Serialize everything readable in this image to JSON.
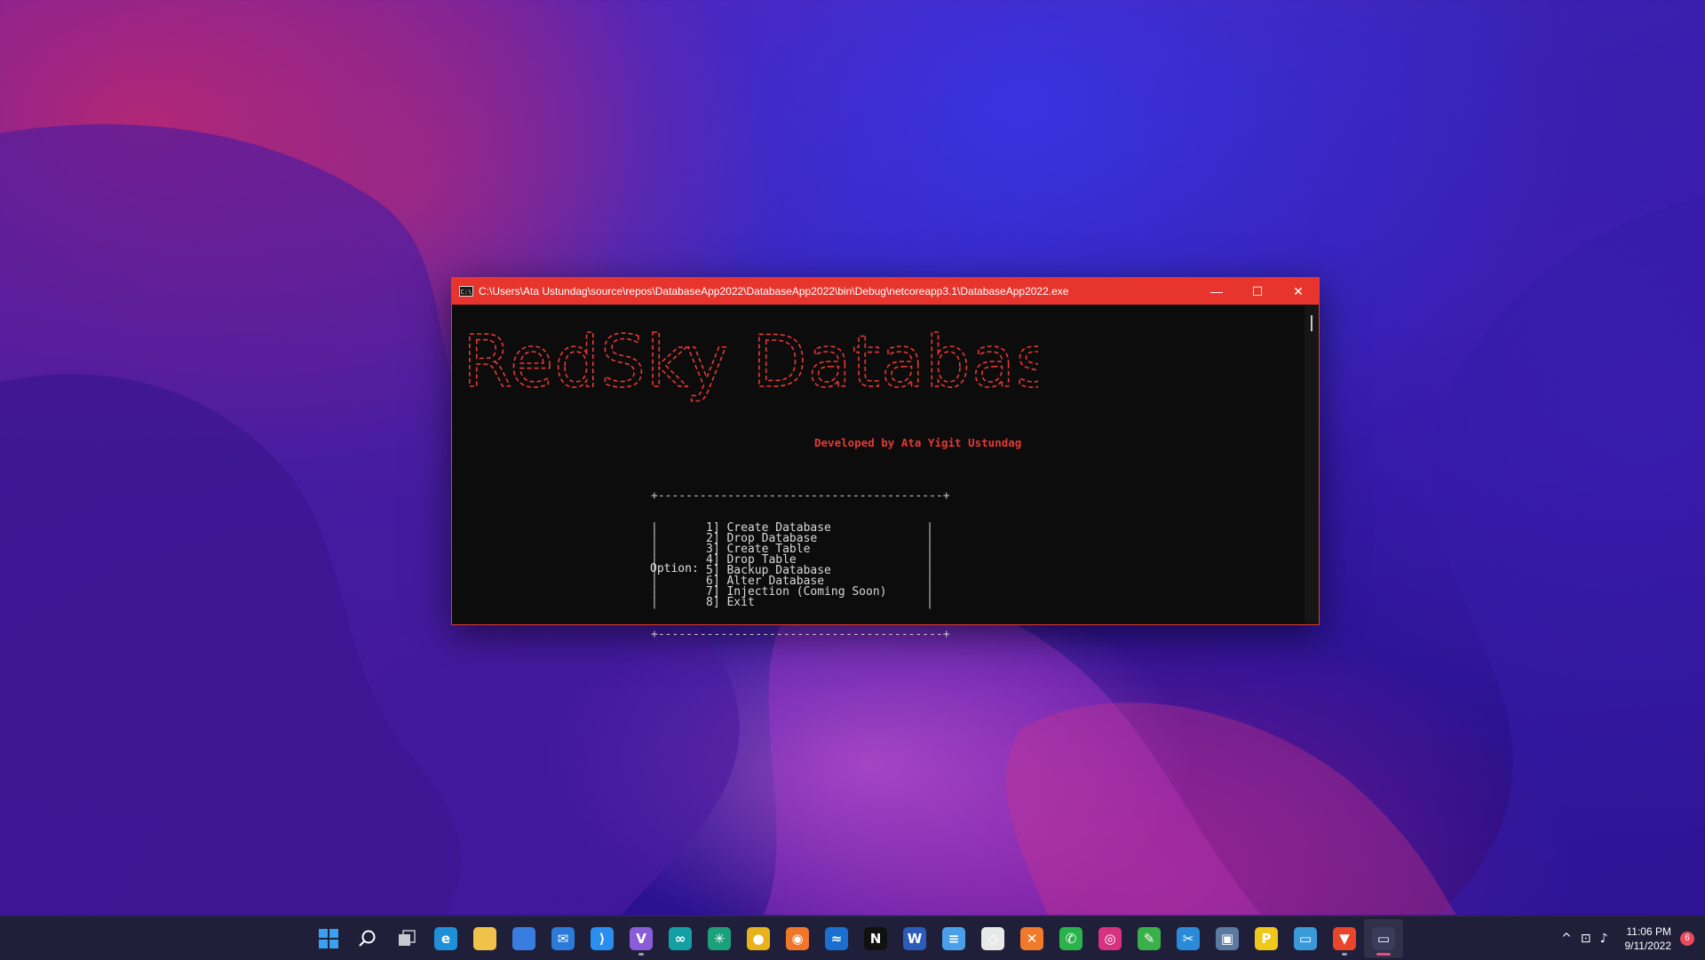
{
  "window": {
    "title": "C:\\Users\\Ata Ustundag\\source\\repos\\DatabaseApp2022\\DatabaseApp2022\\bin\\Debug\\netcoreapp3.1\\DatabaseApp2022.exe",
    "icon": "console-app-icon",
    "icon_label": "C:\\",
    "controls": {
      "minimize": "—",
      "maximize": "☐",
      "close": "✕"
    }
  },
  "console": {
    "banner": "RedSky Database",
    "banner_color": "#e53935",
    "developer": "Developed by Ata Yigit Ustundag",
    "menu_border_top": "+-----------------------------------------+",
    "menu_border_side": "|",
    "menu": [
      "1] Create Database",
      "2] Drop Database",
      "3] Create Table",
      "4] Drop Table",
      "5] Backup Database",
      "6] Alter Database",
      "7] Injection (Coming Soon)",
      "8] Exit"
    ],
    "prompt": "Option:"
  },
  "taskbar": {
    "apps": [
      {
        "name": "start-icon",
        "glyph": "",
        "color": "#2f8cf0"
      },
      {
        "name": "search-icon",
        "glyph": "",
        "color": "transparent"
      },
      {
        "name": "task-view-icon",
        "glyph": "",
        "color": "transparent"
      },
      {
        "name": "edge-icon",
        "glyph": "e",
        "color": "#1f8fd8"
      },
      {
        "name": "file-explorer-icon",
        "glyph": "",
        "color": "#f0c24a"
      },
      {
        "name": "store-icon",
        "glyph": "",
        "color": "#3a7de0"
      },
      {
        "name": "mail-icon",
        "glyph": "✉",
        "color": "#2a7ad8"
      },
      {
        "name": "vscode-icon",
        "glyph": "⟩",
        "color": "#2a8ef0"
      },
      {
        "name": "visual-studio-icon",
        "glyph": "V",
        "color": "#8a5cd8"
      },
      {
        "name": "arduino-icon",
        "glyph": "∞",
        "color": "#13a0a5"
      },
      {
        "name": "chatgpt-icon",
        "glyph": "✳",
        "color": "#1aa07a"
      },
      {
        "name": "chrome-icon",
        "glyph": "●",
        "color": "#e8b21a"
      },
      {
        "name": "firefox-icon",
        "glyph": "◉",
        "color": "#f0762a"
      },
      {
        "name": "whiteboard-icon",
        "glyph": "≈",
        "color": "#1a6fd0"
      },
      {
        "name": "netflix-icon",
        "glyph": "N",
        "color": "#111111"
      },
      {
        "name": "word-icon",
        "glyph": "W",
        "color": "#2b5db8"
      },
      {
        "name": "notepad-icon",
        "glyph": "≡",
        "color": "#4aa0e8"
      },
      {
        "name": "unity-icon",
        "glyph": "◇",
        "color": "#e8e8e8"
      },
      {
        "name": "xampp-icon",
        "glyph": "✕",
        "color": "#f07a2a"
      },
      {
        "name": "whatsapp-icon",
        "glyph": "✆",
        "color": "#2ab34a"
      },
      {
        "name": "instagram-icon",
        "glyph": "◎",
        "color": "#d6327f"
      },
      {
        "name": "chat-app-icon",
        "glyph": "✎",
        "color": "#3ab04a"
      },
      {
        "name": "snipping-tool-icon",
        "glyph": "✂",
        "color": "#2a8ad8"
      },
      {
        "name": "app-installer-icon",
        "glyph": "▣",
        "color": "#5a7aa0"
      },
      {
        "name": "powertoys-icon",
        "glyph": "P",
        "color": "#f0c81a"
      },
      {
        "name": "remote-desktop-icon",
        "glyph": "▭",
        "color": "#3a9ad8"
      },
      {
        "name": "brave-icon",
        "glyph": "▼",
        "color": "#e8452a"
      },
      {
        "name": "console-taskbar-icon",
        "glyph": "▭",
        "color": "#3a3a5a"
      }
    ],
    "tray": {
      "chevron": "^",
      "network": "⊡",
      "volume": "♪",
      "time": "11:06 PM",
      "date": "9/11/2022",
      "notifications": "6"
    }
  }
}
